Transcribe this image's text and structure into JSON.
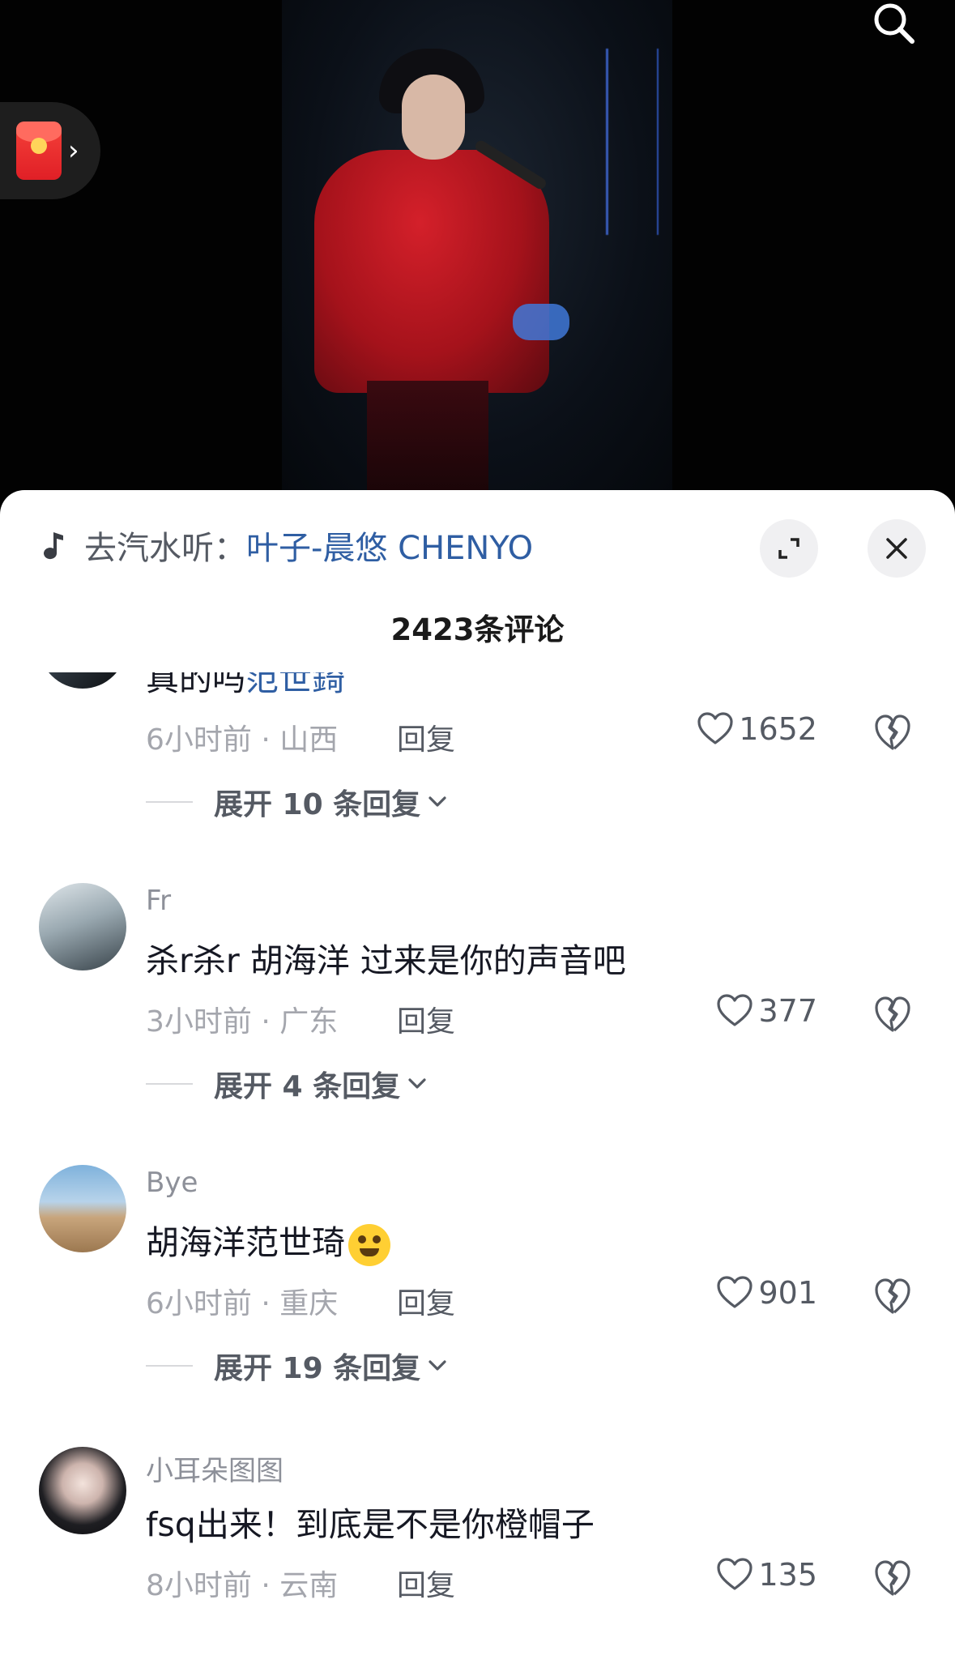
{
  "music": {
    "prefix": "去汽水听：",
    "title": "叶子-晨悠 CHENYO"
  },
  "comments_header": {
    "count_label": "2423条评论"
  },
  "comments": [
    {
      "username": "",
      "text": "真的吗",
      "mention": "范世錡",
      "time_location": "6小时前 · 山西",
      "reply_label": "回复",
      "likes": "1652",
      "expand_label": "展开 10 条回复"
    },
    {
      "username": "Fr",
      "text": "杀r杀r 胡海洋 过来是你的声音吧",
      "time_location": "3小时前 · 广东",
      "reply_label": "回复",
      "likes": "377",
      "expand_label": "展开 4 条回复"
    },
    {
      "username": "Bye",
      "text": "胡海洋范世琦",
      "emoji": "grinning-emoji",
      "time_location": "6小时前 · 重庆",
      "reply_label": "回复",
      "likes": "901",
      "expand_label": "展开 19 条回复"
    },
    {
      "username": "小耳朵图图",
      "text": "fsq出来！到底是不是你橙帽子",
      "time_location": "8小时前 · 云南",
      "reply_label": "回复",
      "likes": "135"
    }
  ],
  "icons": {
    "search": "search-icon",
    "red_packet": "red-packet-icon",
    "music_note": "music-note-icon",
    "expand": "expand-icon",
    "close": "close-icon",
    "like": "heart-icon",
    "dislike": "broken-heart-icon",
    "chevron": "chevron-down-icon"
  },
  "colors": {
    "link_blue": "#2f5ea3",
    "secondary_text": "#a4a6ad",
    "red_packet": "#e01f26"
  }
}
